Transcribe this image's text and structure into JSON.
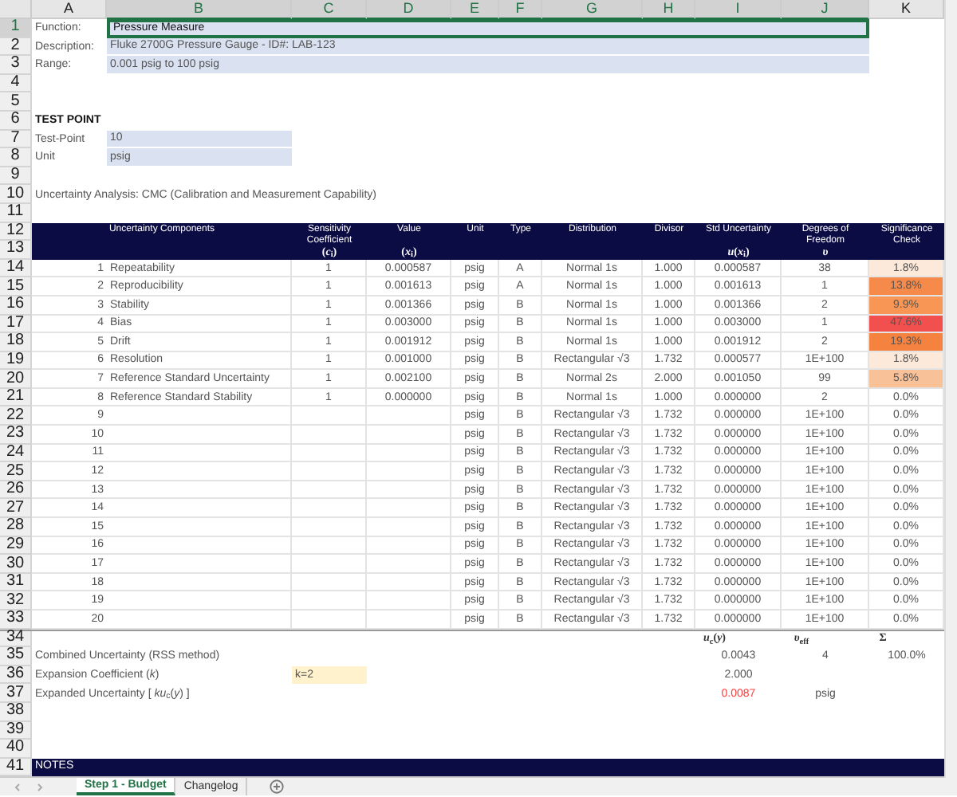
{
  "column_headers": [
    {
      "label": "A",
      "selected": false
    },
    {
      "label": "B",
      "selected": true
    },
    {
      "label": "C",
      "selected": true
    },
    {
      "label": "D",
      "selected": true
    },
    {
      "label": "E",
      "selected": true
    },
    {
      "label": "F",
      "selected": true
    },
    {
      "label": "G",
      "selected": true
    },
    {
      "label": "H",
      "selected": true
    },
    {
      "label": "I",
      "selected": true
    },
    {
      "label": "J",
      "selected": true
    },
    {
      "label": "K",
      "selected": false
    }
  ],
  "row_headers": [
    {
      "label": "1",
      "selected": true
    },
    {
      "label": "2",
      "selected": false
    },
    {
      "label": "3",
      "selected": false
    },
    {
      "label": "4",
      "selected": false
    },
    {
      "label": "5",
      "selected": false
    },
    {
      "label": "6",
      "selected": false
    },
    {
      "label": "7",
      "selected": false
    },
    {
      "label": "8",
      "selected": false
    },
    {
      "label": "9",
      "selected": false
    },
    {
      "label": "10",
      "selected": false
    },
    {
      "label": "11",
      "selected": false
    },
    {
      "label": "12",
      "selected": false
    },
    {
      "label": "13",
      "selected": false
    },
    {
      "label": "14",
      "selected": false
    },
    {
      "label": "15",
      "selected": false
    },
    {
      "label": "16",
      "selected": false
    },
    {
      "label": "17",
      "selected": false
    },
    {
      "label": "18",
      "selected": false
    },
    {
      "label": "19",
      "selected": false
    },
    {
      "label": "20",
      "selected": false
    },
    {
      "label": "21",
      "selected": false
    },
    {
      "label": "22",
      "selected": false
    },
    {
      "label": "23",
      "selected": false
    },
    {
      "label": "24",
      "selected": false
    },
    {
      "label": "25",
      "selected": false
    },
    {
      "label": "26",
      "selected": false
    },
    {
      "label": "27",
      "selected": false
    },
    {
      "label": "28",
      "selected": false
    },
    {
      "label": "29",
      "selected": false
    },
    {
      "label": "30",
      "selected": false
    },
    {
      "label": "31",
      "selected": false
    },
    {
      "label": "32",
      "selected": false
    },
    {
      "label": "33",
      "selected": false
    },
    {
      "label": "34",
      "selected": false
    },
    {
      "label": "35",
      "selected": false
    },
    {
      "label": "36",
      "selected": false
    },
    {
      "label": "37",
      "selected": false
    },
    {
      "label": "38",
      "selected": false
    },
    {
      "label": "39",
      "selected": false
    },
    {
      "label": "40",
      "selected": false
    },
    {
      "label": "41",
      "selected": false
    }
  ],
  "info": [
    {
      "label": "Function:",
      "value": "Pressure Measure",
      "selected": true
    },
    {
      "label": "Description:",
      "value": "Fluke 2700G Pressure Gauge - ID#: LAB-123",
      "selected": false
    },
    {
      "label": "Range:",
      "value": "0.001 psig to 100 psig",
      "selected": false
    }
  ],
  "test_point": {
    "heading": "TEST POINT",
    "fields": [
      {
        "label": "Test-Point",
        "value": "10"
      },
      {
        "label": "Unit",
        "value": "psig"
      }
    ]
  },
  "analysis_title": "Uncertainty Analysis: CMC (Calibration and Measurement Capability)",
  "table": {
    "columns": [
      {
        "label": "Uncertainty Components"
      },
      {
        "label": "Sensitivity Coefficient",
        "symbol": "(*c*$_{i}$)"
      },
      {
        "label": "Value",
        "symbol": "(*x*$_{i}$)"
      },
      {
        "label": "Unit"
      },
      {
        "label": "Type"
      },
      {
        "label": "Distribution"
      },
      {
        "label": "Divisor"
      },
      {
        "label": "Std Uncertainty",
        "symbol": "*u*(*x*$_{i}$)"
      },
      {
        "label": "Degrees of Freedom",
        "symbol": "*υ*"
      },
      {
        "label": "Significance Check"
      }
    ],
    "rows": [
      {
        "number": "1",
        "component": "Repeatability",
        "coefficient": "1",
        "value": "0.000587",
        "unit": "psig",
        "type": "A",
        "distribution": "Normal 1s",
        "divisor": "1.000",
        "std": "0.000587",
        "dof": "38",
        "significance": "1.8%",
        "color": "#fde9d9"
      },
      {
        "number": "2",
        "component": "Reproducibility",
        "coefficient": "1",
        "value": "0.001613",
        "unit": "psig",
        "type": "A",
        "distribution": "Normal 1s",
        "divisor": "1.000",
        "std": "0.001613",
        "dof": "1",
        "significance": "13.8%",
        "color": "#f58a4a"
      },
      {
        "number": "3",
        "component": "Stability",
        "coefficient": "1",
        "value": "0.001366",
        "unit": "psig",
        "type": "B",
        "distribution": "Normal 1s",
        "divisor": "1.000",
        "std": "0.001366",
        "dof": "2",
        "significance": "9.9%",
        "color": "#f79655"
      },
      {
        "number": "4",
        "component": "Bias",
        "coefficient": "1",
        "value": "0.003000",
        "unit": "psig",
        "type": "B",
        "distribution": "Normal 1s",
        "divisor": "1.000",
        "std": "0.003000",
        "dof": "1",
        "significance": "47.6%",
        "color": "#f2504e"
      },
      {
        "number": "5",
        "component": "Drift",
        "coefficient": "1",
        "value": "0.001912",
        "unit": "psig",
        "type": "B",
        "distribution": "Normal 1s",
        "divisor": "1.000",
        "std": "0.001912",
        "dof": "2",
        "significance": "19.3%",
        "color": "#f5823f"
      },
      {
        "number": "6",
        "component": "Resolution",
        "coefficient": "1",
        "value": "0.001000",
        "unit": "psig",
        "type": "B",
        "distribution": "Rectangular √3",
        "divisor": "1.732",
        "std": "0.000577",
        "dof": "1E+100",
        "significance": "1.8%",
        "color": "#fde9d9"
      },
      {
        "number": "7",
        "component": "Reference Standard Uncertainty",
        "coefficient": "1",
        "value": "0.002100",
        "unit": "psig",
        "type": "B",
        "distribution": "Normal 2s",
        "divisor": "2.000",
        "std": "0.001050",
        "dof": "99",
        "significance": "5.8%",
        "color": "#f9c198"
      },
      {
        "number": "8",
        "component": "Reference Standard Stability",
        "coefficient": "1",
        "value": "0.000000",
        "unit": "psig",
        "type": "B",
        "distribution": "Normal 1s",
        "divisor": "1.000",
        "std": "0.000000",
        "dof": "2",
        "significance": "0.0%",
        "color": "#ffffff"
      },
      {
        "number": "9",
        "unit": "psig",
        "type": "B",
        "distribution": "Rectangular √3",
        "divisor": "1.732",
        "std": "0.000000",
        "dof": "1E+100",
        "significance": "0.0%",
        "color": "#ffffff"
      },
      {
        "number": "10",
        "unit": "psig",
        "type": "B",
        "distribution": "Rectangular √3",
        "divisor": "1.732",
        "std": "0.000000",
        "dof": "1E+100",
        "significance": "0.0%",
        "color": "#ffffff"
      },
      {
        "number": "11",
        "unit": "psig",
        "type": "B",
        "distribution": "Rectangular √3",
        "divisor": "1.732",
        "std": "0.000000",
        "dof": "1E+100",
        "significance": "0.0%",
        "color": "#ffffff"
      },
      {
        "number": "12",
        "unit": "psig",
        "type": "B",
        "distribution": "Rectangular √3",
        "divisor": "1.732",
        "std": "0.000000",
        "dof": "1E+100",
        "significance": "0.0%",
        "color": "#ffffff"
      },
      {
        "number": "13",
        "unit": "psig",
        "type": "B",
        "distribution": "Rectangular √3",
        "divisor": "1.732",
        "std": "0.000000",
        "dof": "1E+100",
        "significance": "0.0%",
        "color": "#ffffff"
      },
      {
        "number": "14",
        "unit": "psig",
        "type": "B",
        "distribution": "Rectangular √3",
        "divisor": "1.732",
        "std": "0.000000",
        "dof": "1E+100",
        "significance": "0.0%",
        "color": "#ffffff"
      },
      {
        "number": "15",
        "unit": "psig",
        "type": "B",
        "distribution": "Rectangular √3",
        "divisor": "1.732",
        "std": "0.000000",
        "dof": "1E+100",
        "significance": "0.0%",
        "color": "#ffffff"
      },
      {
        "number": "16",
        "unit": "psig",
        "type": "B",
        "distribution": "Rectangular √3",
        "divisor": "1.732",
        "std": "0.000000",
        "dof": "1E+100",
        "significance": "0.0%",
        "color": "#ffffff"
      },
      {
        "number": "17",
        "unit": "psig",
        "type": "B",
        "distribution": "Rectangular √3",
        "divisor": "1.732",
        "std": "0.000000",
        "dof": "1E+100",
        "significance": "0.0%",
        "color": "#ffffff"
      },
      {
        "number": "18",
        "unit": "psig",
        "type": "B",
        "distribution": "Rectangular √3",
        "divisor": "1.732",
        "std": "0.000000",
        "dof": "1E+100",
        "significance": "0.0%",
        "color": "#ffffff"
      },
      {
        "number": "19",
        "unit": "psig",
        "type": "B",
        "distribution": "Rectangular √3",
        "divisor": "1.732",
        "std": "0.000000",
        "dof": "1E+100",
        "significance": "0.0%",
        "color": "#ffffff"
      },
      {
        "number": "20",
        "unit": "psig",
        "type": "B",
        "distribution": "Rectangular √3",
        "divisor": "1.732",
        "std": "0.000000",
        "dof": "1E+100",
        "significance": "0.0%",
        "color": "#ffffff"
      }
    ]
  },
  "summary": {
    "symbols": [
      "*u*$_{c}$(*y*)",
      "*υ*$_{eff}$",
      "Σ"
    ],
    "rows": [
      {
        "label": "Combined Uncertainty (RSS method)",
        "std": "0.0043",
        "dof": "4",
        "sig": "100.0%",
        "emphasis": false
      },
      {
        "label": "Expansion Coefficient (*k*)",
        "input": "k=2",
        "std": "2.000",
        "emphasis": false
      },
      {
        "label": "Expanded Uncertainty [ *ku*$_{c}$(*y*) ]",
        "std": "0.0087",
        "dof": "psig",
        "emphasis": true
      }
    ]
  },
  "notes_title": "NOTES",
  "sheet_tabs": [
    {
      "label": "Step 1 - Budget",
      "selected": true
    },
    {
      "label": "Changelog",
      "selected": false
    }
  ]
}
